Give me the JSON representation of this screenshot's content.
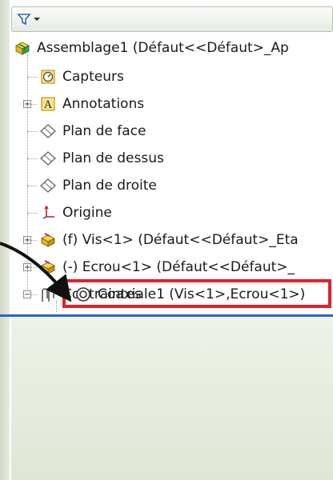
{
  "tree": {
    "root": {
      "label": "Assemblage1  (Défaut<<Défaut>_Ap"
    },
    "items": [
      {
        "label": "Capteurs"
      },
      {
        "label": "Annotations"
      },
      {
        "label": "Plan de face"
      },
      {
        "label": "Plan de dessus"
      },
      {
        "label": "Plan de droite"
      },
      {
        "label": "Origine"
      },
      {
        "label": "(f) Vis<1> (Défaut<<Défaut>_Eta"
      },
      {
        "label": "(-) Ecrou<1> (Défaut<<Défaut>_"
      },
      {
        "label": "Contraintes"
      }
    ],
    "mate": {
      "label": "Coaxiale1 (Vis<1>,Ecrou<1>)"
    }
  },
  "colors": {
    "highlight": "#e2202a",
    "separator": "#2b63c6",
    "arrow": "#111111"
  }
}
